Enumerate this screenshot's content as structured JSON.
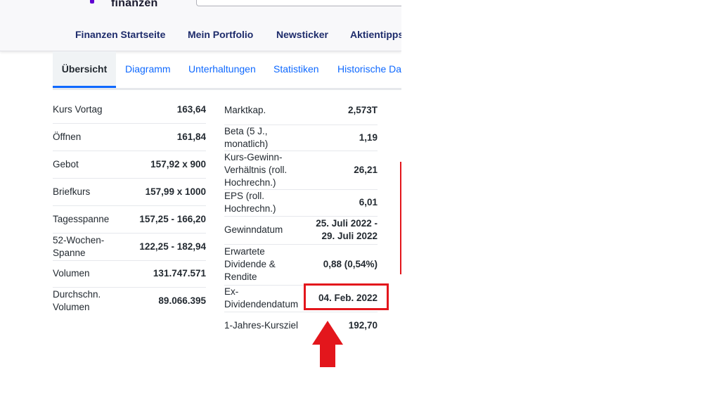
{
  "header": {
    "logo_text": "finanzen",
    "nav": [
      "Finanzen Startseite",
      "Mein Portfolio",
      "Newsticker",
      "Aktientipps"
    ]
  },
  "tabs": [
    "Übersicht",
    "Diagramm",
    "Unterhaltungen",
    "Statistiken",
    "Historische Da"
  ],
  "left_table": [
    {
      "label": "Kurs Vortag",
      "value": "163,64"
    },
    {
      "label": "Öffnen",
      "value": "161,84"
    },
    {
      "label": "Gebot",
      "value": "157,92 x 900"
    },
    {
      "label": "Briefkurs",
      "value": "157,99 x 1000"
    },
    {
      "label": "Tagesspanne",
      "value": "157,25 - 166,20"
    },
    {
      "label": "52-Wochen-\nSpanne",
      "value": "122,25 - 182,94"
    },
    {
      "label": "Volumen",
      "value": "131.747.571"
    },
    {
      "label": "Durchschn.\nVolumen",
      "value": "89.066.395"
    }
  ],
  "right_table": [
    {
      "label": "Marktkap.",
      "value": "2,573T"
    },
    {
      "label": "Beta (5 J.,\nmonatlich)",
      "value": "1,19"
    },
    {
      "label": "Kurs-Gewinn-\nVerhältnis (roll.\nHochrechn.)",
      "value": "26,21"
    },
    {
      "label": "EPS (roll.\nHochrechn.)",
      "value": "6,01"
    },
    {
      "label": "Gewinndatum",
      "value": "25. Juli 2022 -\n29. Juli 2022"
    },
    {
      "label": "Erwartete\nDividende &\nRendite",
      "value": "0,88 (0,54%)"
    },
    {
      "label": "Ex-\nDividendendatum",
      "value": "04. Feb. 2022"
    },
    {
      "label": "1-Jahres-Kursziel",
      "value": "192,70"
    }
  ],
  "annotation_color": "#e3161c"
}
